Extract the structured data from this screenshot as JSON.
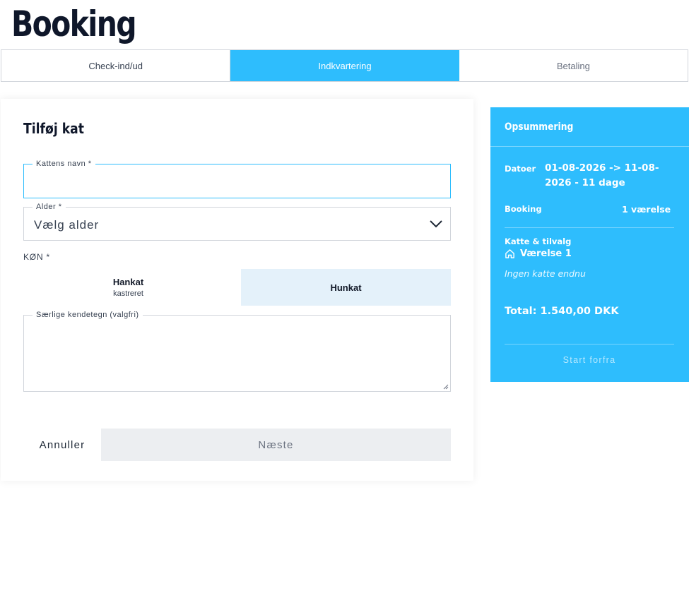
{
  "page": {
    "title": "Booking"
  },
  "steps": [
    {
      "label": "Check-ind/ud"
    },
    {
      "label": "Indkvartering"
    },
    {
      "label": "Betaling"
    }
  ],
  "form": {
    "title": "Tilføj kat",
    "name_field": {
      "label": "Kattens navn *",
      "value": ""
    },
    "age_field": {
      "label": "Alder *",
      "value": "Vælg alder"
    },
    "gender": {
      "label": "KØN *",
      "male": {
        "title": "Hankat",
        "subtitle": "kastreret"
      },
      "female": {
        "title": "Hunkat"
      }
    },
    "features_field": {
      "label": "Særlige kendetegn (valgfri)",
      "value": ""
    },
    "cancel_label": "Annuller",
    "next_label": "Næste"
  },
  "summary": {
    "title": "Opsummering",
    "dates_label": "Datoer",
    "dates_value": "01-08-2026 -> 11-08-2026 - 11 dage",
    "booking_label": "Booking",
    "booking_value": "1 værelse",
    "cats_label": "Katte & tilvalg",
    "room_label": "Værelse 1",
    "no_cats": "Ingen katte endnu",
    "total": "Total: 1.540,00 DKK",
    "restart_label": "Start forfra"
  },
  "colors": {
    "accent": "#2ebdfd",
    "selected_option": "#e4f1fa",
    "disabled_button": "#eceef1"
  },
  "icons": {
    "age_select": "chevron-down-icon",
    "room": "house-icon"
  }
}
